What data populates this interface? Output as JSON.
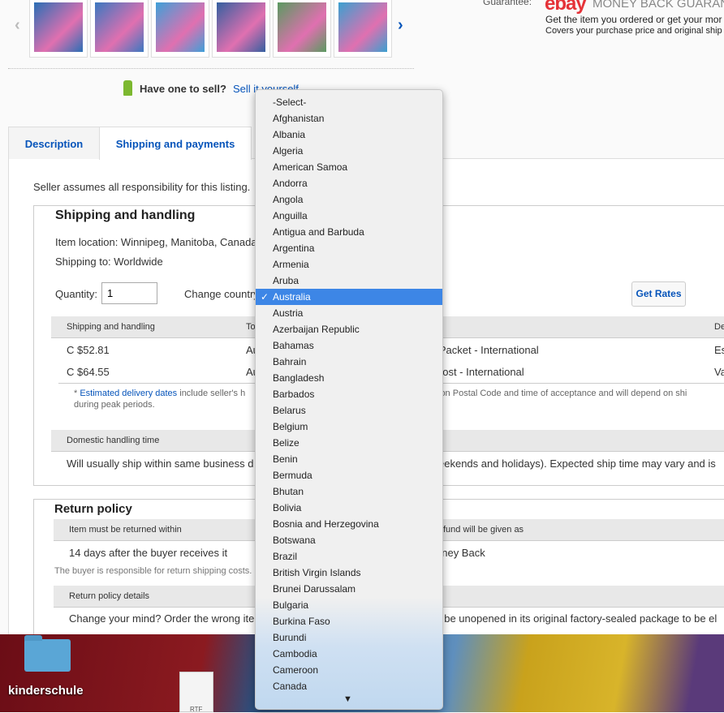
{
  "gallery": {
    "thumb_colors": [
      "#2a6fb5",
      "#3a78c0",
      "#3ea0d8",
      "#3460a0",
      "#5a9a60",
      "#3aa0d0"
    ]
  },
  "guarantee": {
    "label": "Guarantee:",
    "logo": "ebay",
    "title": "MONEY BACK GUARANT",
    "line1": "Get the item you ordered or get your mor",
    "line2": "Covers your purchase price and original ship"
  },
  "sell": {
    "question": "Have one to sell?",
    "link": "Sell it yourself"
  },
  "tabs": [
    {
      "label": "Description"
    },
    {
      "label": "Shipping and payments",
      "active": true
    }
  ],
  "seller_note": "Seller assumes all responsibility for this listing.",
  "shipping": {
    "title": "Shipping and handling",
    "item_location": "Item location: Winnipeg, Manitoba, Canada",
    "shipping_to": "Shipping to: Worldwide",
    "quantity_label": "Quantity:",
    "quantity_value": "1",
    "change_country_label": "Change country",
    "get_rates": "Get Rates",
    "headers": [
      "Shipping and handling",
      "To",
      "De"
    ],
    "rows": [
      [
        "C $52.81",
        "Au",
        "d Packet - International",
        "Es"
      ],
      [
        "C $64.55",
        "Au",
        "post - International",
        "Va"
      ]
    ],
    "note_link": "Estimated delivery dates",
    "note_a": " include seller's h",
    "note_b": "ion Postal Code and time of acceptance and will depend on shi",
    "note_c": "during peak periods.",
    "handling_header": "Domestic handling time",
    "handling_a": "Will usually ship within same business d",
    "handling_b": "eekends and holidays). Expected ship time may vary and is"
  },
  "returns": {
    "title": "Return policy",
    "header1": "Item must be returned within",
    "header2": "fund will be given as",
    "value1": "14 days after the buyer receives it",
    "value2": "oney Back",
    "note": "The buyer is responsible for return shipping costs.",
    "details_header": "Return policy details",
    "details_a": "Change your mind? Order the wrong ite",
    "details_b": "t be unopened in its original factory-sealed package to be el"
  },
  "dropdown": {
    "selected": "Australia",
    "options": [
      "-Select-",
      "Afghanistan",
      "Albania",
      "Algeria",
      "American Samoa",
      "Andorra",
      "Angola",
      "Anguilla",
      "Antigua and Barbuda",
      "Argentina",
      "Armenia",
      "Aruba",
      "Australia",
      "Austria",
      "Azerbaijan Republic",
      "Bahamas",
      "Bahrain",
      "Bangladesh",
      "Barbados",
      "Belarus",
      "Belgium",
      "Belize",
      "Benin",
      "Bermuda",
      "Bhutan",
      "Bolivia",
      "Bosnia and Herzegovina",
      "Botswana",
      "Brazil",
      "British Virgin Islands",
      "Brunei Darussalam",
      "Bulgaria",
      "Burkina Faso",
      "Burundi",
      "Cambodia",
      "Cameroon",
      "Canada"
    ]
  },
  "desktop": {
    "folder_label": "kinderschule",
    "file_label": "RTF"
  },
  "colors": {
    "link": "#0654ba",
    "highlight": "#3d86e6"
  }
}
